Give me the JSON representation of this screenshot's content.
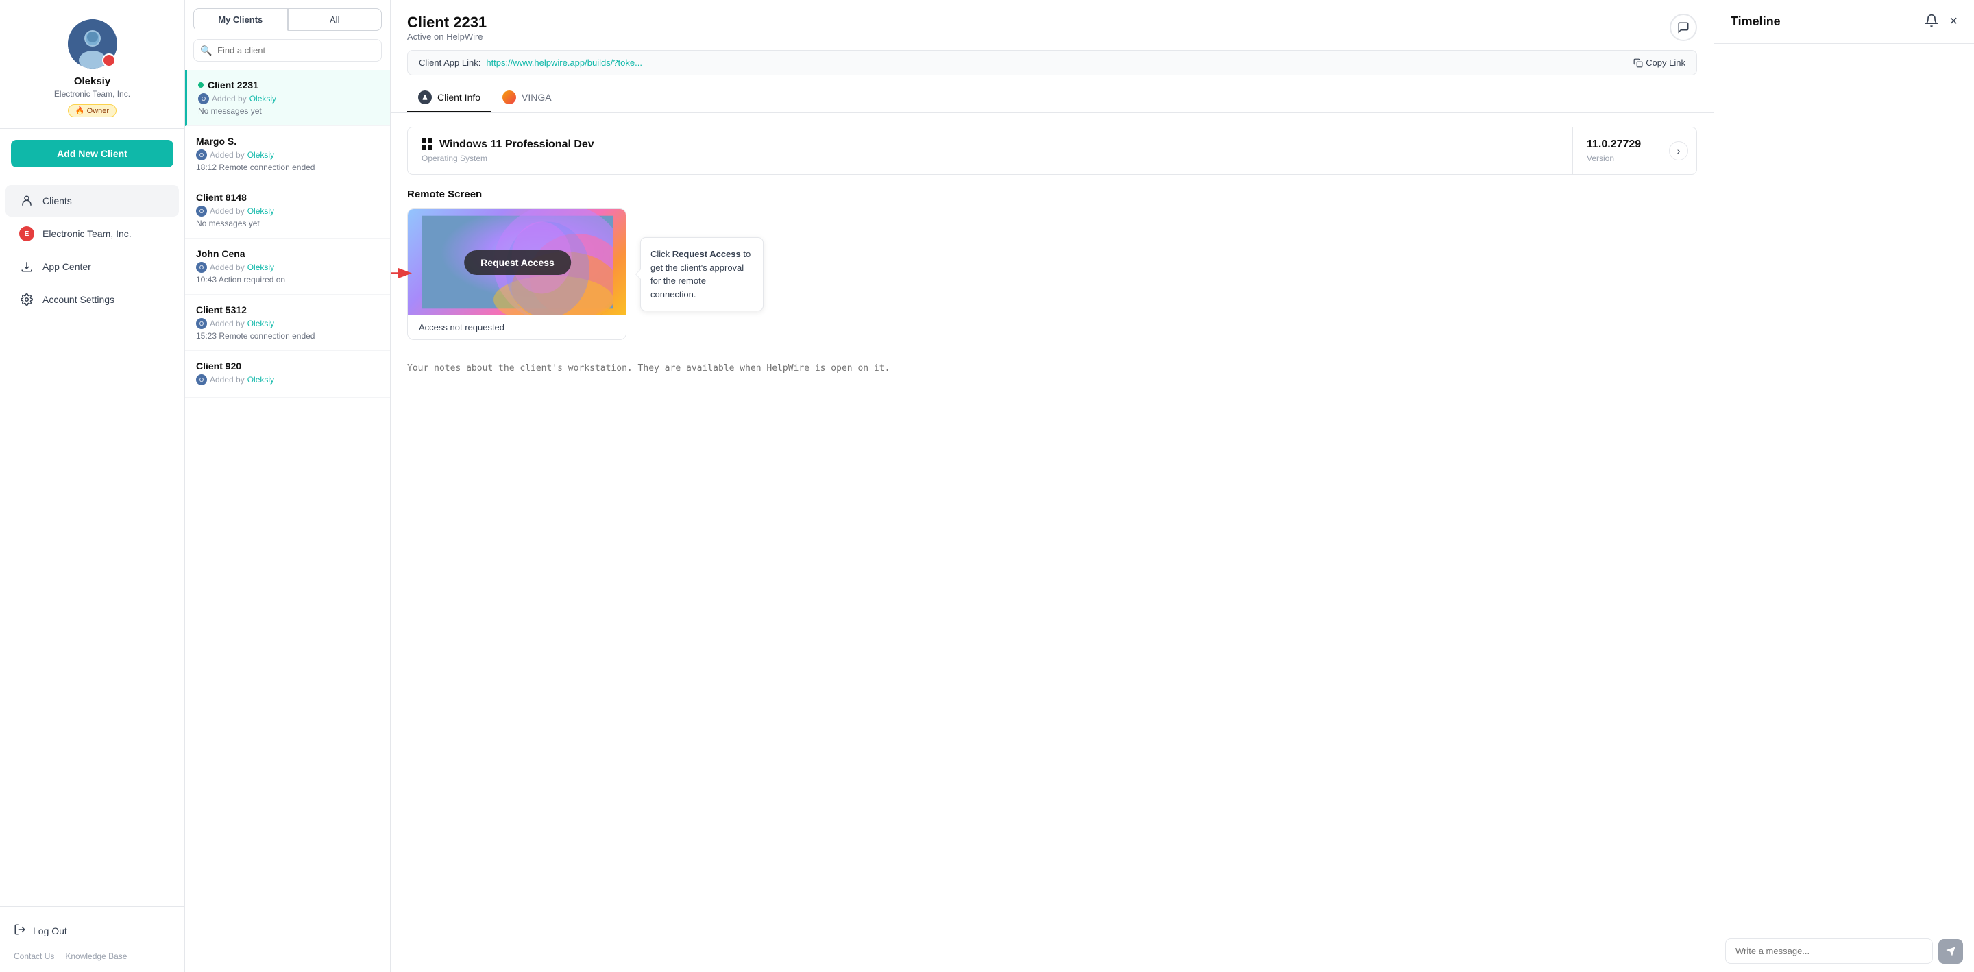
{
  "sidebar": {
    "profile": {
      "name": "Oleksiy",
      "company": "Electronic Team, Inc.",
      "role": "🔥 Owner"
    },
    "add_client_label": "Add New Client",
    "nav": [
      {
        "id": "clients",
        "label": "Clients",
        "icon": "person"
      },
      {
        "id": "electronic-team",
        "label": "Electronic Team, Inc.",
        "icon": "et"
      },
      {
        "id": "app-center",
        "label": "App Center",
        "icon": "download"
      },
      {
        "id": "account-settings",
        "label": "Account Settings",
        "icon": "gear"
      }
    ],
    "logout_label": "Log Out",
    "footer_links": [
      {
        "id": "contact-us",
        "label": "Contact Us"
      },
      {
        "id": "knowledge-base",
        "label": "Knowledge Base"
      }
    ]
  },
  "client_list": {
    "tabs": [
      {
        "id": "my-clients",
        "label": "My Clients",
        "active": true
      },
      {
        "id": "all",
        "label": "All"
      }
    ],
    "search_placeholder": "Find a client",
    "clients": [
      {
        "id": "2231",
        "name": "Client 2231",
        "added_by": "Oleksiy",
        "message": "No messages yet",
        "online": true,
        "active": true
      },
      {
        "id": "margo",
        "name": "Margo S.",
        "added_by": "Oleksiy",
        "message": "18:12  Remote connection ended",
        "online": false,
        "active": false
      },
      {
        "id": "8148",
        "name": "Client 8148",
        "added_by": "Oleksiy",
        "message": "No messages yet",
        "online": false,
        "active": false
      },
      {
        "id": "john-cena",
        "name": "John Cena",
        "added_by": "Oleksiy",
        "message": "10:43  Action required on",
        "online": false,
        "active": false
      },
      {
        "id": "5312",
        "name": "Client 5312",
        "added_by": "Oleksiy",
        "message": "15:23  Remote connection ended",
        "online": false,
        "active": false
      },
      {
        "id": "920",
        "name": "Client 920",
        "added_by": "Oleksiy",
        "message": "",
        "online": false,
        "active": false
      }
    ]
  },
  "client_detail": {
    "title": "Client 2231",
    "status": "Active on HelpWire",
    "app_link_label": "Client App Link:",
    "app_link_url": "https://www.helpwire.app/builds/?toke...",
    "copy_link_label": "Copy Link",
    "tabs": [
      {
        "id": "client-info",
        "label": "Client Info",
        "active": true
      },
      {
        "id": "vinga",
        "label": "VINGA"
      }
    ],
    "os": {
      "name": "Windows 11 Professional Dev",
      "os_label": "Operating System",
      "version": "11.0.27729",
      "version_label": "Version"
    },
    "remote_screen": {
      "title": "Remote Screen",
      "request_btn": "Request Access",
      "access_status": "Access not requested",
      "tooltip": {
        "text_before": "Click ",
        "bold": "Request Access",
        "text_after": " to get the client's approval for the remote connection."
      }
    },
    "notes_placeholder": "Your notes about the client's workstation. They are available when HelpWire is open on it."
  },
  "timeline": {
    "title": "Timeline",
    "message_placeholder": "Write a message..."
  }
}
